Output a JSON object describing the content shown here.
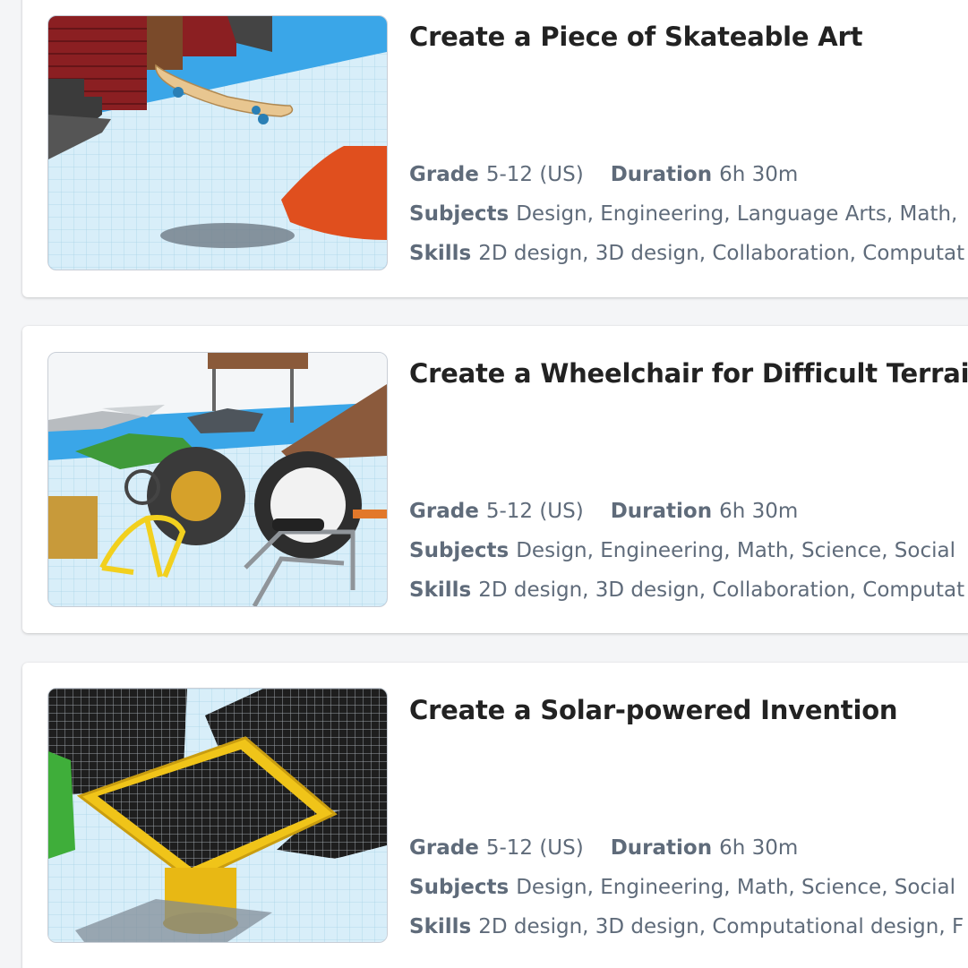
{
  "labels": {
    "grade": "Grade",
    "duration": "Duration",
    "subjects": "Subjects",
    "skills": "Skills"
  },
  "cards": [
    {
      "title": "Create a Piece of Skateable Art",
      "grade": "5-12 (US)",
      "duration": "6h 30m",
      "subjects": "Design, Engineering, Language Arts, Math,",
      "skills": "2D design, 3D design, Collaboration, Computat"
    },
    {
      "title": "Create a Wheelchair for Difficult Terrain",
      "grade": "5-12 (US)",
      "duration": "6h 30m",
      "subjects": "Design, Engineering, Math, Science, Social",
      "skills": "2D design, 3D design, Collaboration, Computat"
    },
    {
      "title": "Create a Solar-powered Invention",
      "grade": "5-12 (US)",
      "duration": "6h 30m",
      "subjects": "Design, Engineering, Math, Science, Social",
      "skills": "2D design, 3D design, Computational design, F"
    }
  ],
  "colors": {
    "title": "#222222",
    "meta": "#5f6b7a",
    "grid_plane": "#d5eef8"
  }
}
